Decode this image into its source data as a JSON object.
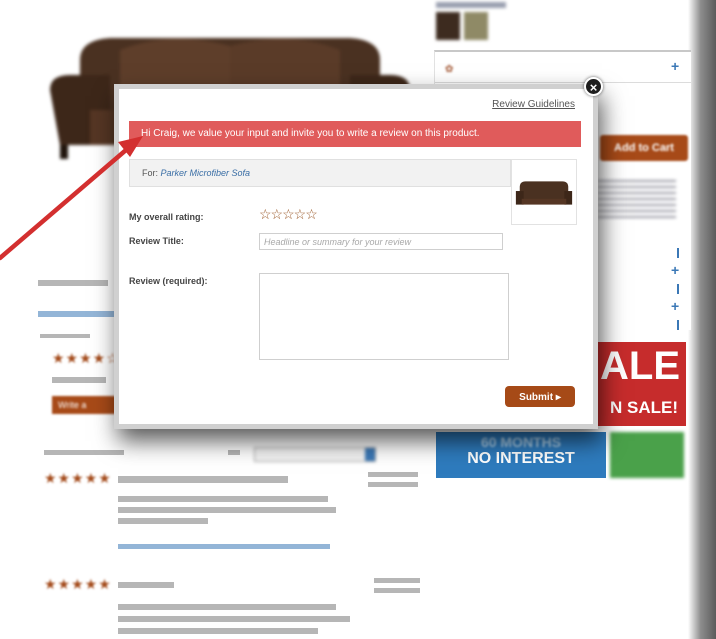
{
  "modal": {
    "guidelines_link": "Review Guidelines",
    "greeting": "Hi Craig, we value your input and invite you to write a review on this product.",
    "for_label": "For:",
    "product_name": "Parker Microfiber Sofa",
    "rating_label": "My overall rating:",
    "rating_stars": "☆☆☆☆☆",
    "title_label": "Review Title:",
    "title_placeholder": "Headline or summary for your review",
    "review_label": "Review (required):",
    "submit_label": "Submit ▸",
    "close_symbol": "×"
  },
  "background": {
    "add_to_cart": "Add to Cart",
    "sale_big": "ALE",
    "sale_small": "N SALE!",
    "interest_months": "60 MONTHS",
    "interest_title": "NO INTEREST",
    "write_review": "Write a Review",
    "review1_stars": "★★★★★",
    "review2_stars": "★★★★★",
    "summary_stars": "★★★★☆"
  },
  "colors": {
    "accent_brown": "#a64a17",
    "banner_red": "#e05b5b",
    "link_blue": "#3a6ea5",
    "sale_red": "#c62c2c",
    "interest_blue": "#2e7bbd",
    "arrow_red": "#d32f2f"
  },
  "icons": [
    "close-icon",
    "star-icon",
    "plus-icon",
    "sofa-image",
    "flower-icon"
  ]
}
